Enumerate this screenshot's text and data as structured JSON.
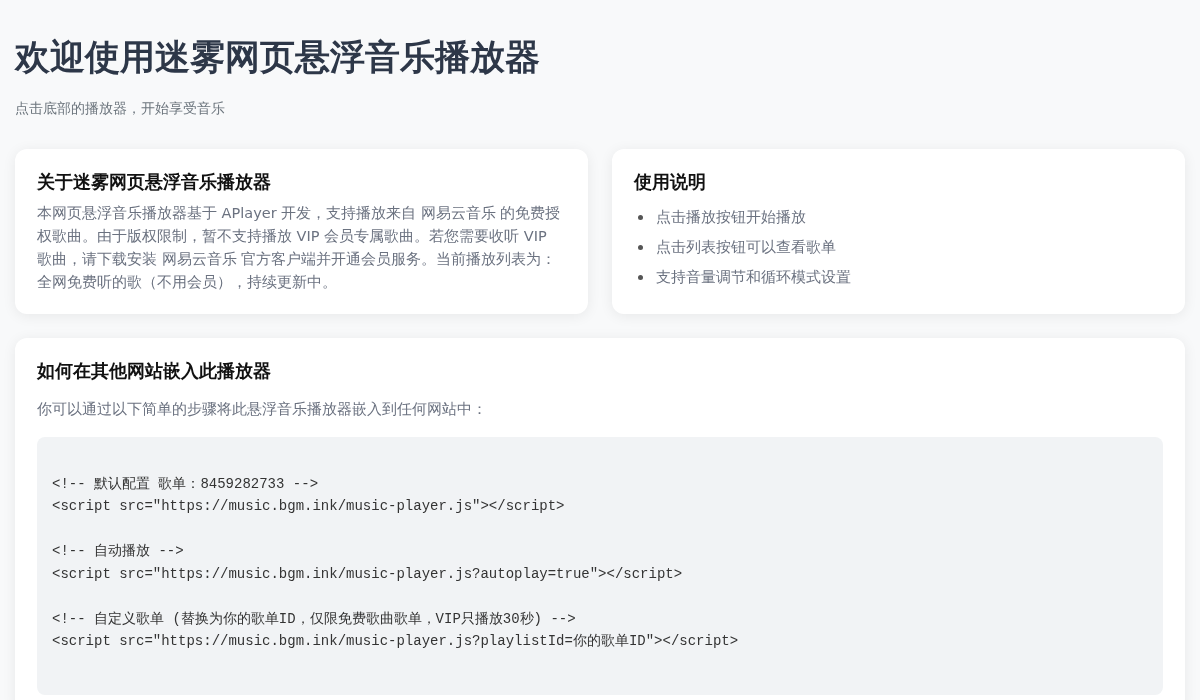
{
  "header": {
    "title": "欢迎使用迷雾网页悬浮音乐播放器",
    "subtitle": "点击底部的播放器，开始享受音乐"
  },
  "about": {
    "title": "关于迷雾网页悬浮音乐播放器",
    "text": "本网页悬浮音乐播放器基于 APlayer 开发，支持播放来自 网易云音乐 的免费授权歌曲。由于版权限制，暂不支持播放 VIP 会员专属歌曲。若您需要收听 VIP 歌曲，请下载安装 网易云音乐 官方客户端并开通会员服务。当前播放列表为：全网免费听的歌（不用会员），持续更新中。"
  },
  "usage": {
    "title": "使用说明",
    "items": [
      "点击播放按钮开始播放",
      "点击列表按钮可以查看歌单",
      "支持音量调节和循环模式设置"
    ]
  },
  "embed": {
    "title": "如何在其他网站嵌入此播放器",
    "intro": "你可以通过以下简单的步骤将此悬浮音乐播放器嵌入到任何网站中：",
    "code_groups": [
      [
        "<!-- 默认配置 歌单：8459282733 -->",
        "<script src=\"https://music.bgm.ink/music-player.js\"></script>"
      ],
      [
        "<!-- 自动播放 -->",
        "<script src=\"https://music.bgm.ink/music-player.js?autoplay=true\"></script>"
      ],
      [
        "<!-- 自定义歌单 (替换为你的歌单ID，仅限免费歌曲歌单，VIP只播放30秒) -->",
        "<script src=\"https://music.bgm.ink/music-player.js?playlistId=你的歌单ID\"></script>"
      ]
    ]
  }
}
